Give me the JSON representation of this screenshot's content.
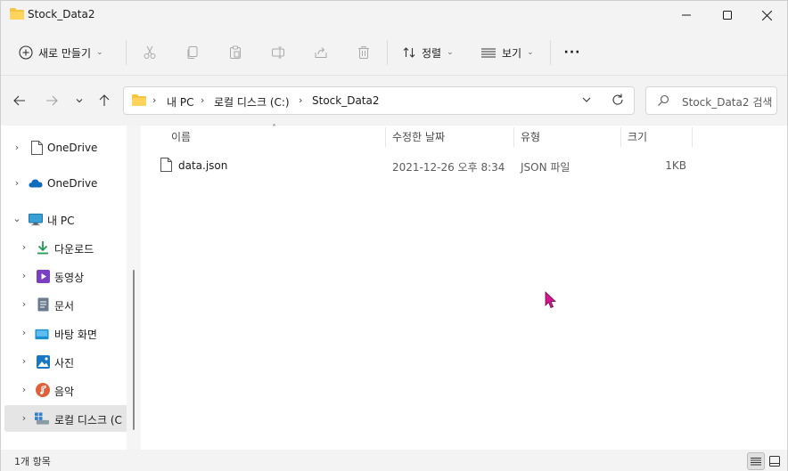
{
  "window": {
    "title": "Stock_Data2",
    "accent": "#e8b400"
  },
  "toolbar": {
    "new_label": "새로 만들기",
    "sort_label": "정렬",
    "view_label": "보기",
    "more_label": "···"
  },
  "address": {
    "crumbs": [
      "내 PC",
      "로컬 디스크 (C:)",
      "Stock_Data2"
    ]
  },
  "search": {
    "placeholder": "Stock_Data2 검색"
  },
  "sidebar": {
    "items": [
      {
        "label": "OneDrive",
        "icon": "document-icon"
      },
      {
        "label": "OneDrive",
        "icon": "cloud-icon"
      },
      {
        "label": "내 PC",
        "icon": "computer-icon"
      },
      {
        "label": "다운로드",
        "icon": "download-icon"
      },
      {
        "label": "동영상",
        "icon": "video-icon"
      },
      {
        "label": "문서",
        "icon": "documents-icon"
      },
      {
        "label": "바탕 화면",
        "icon": "desktop-icon"
      },
      {
        "label": "사진",
        "icon": "pictures-icon"
      },
      {
        "label": "음악",
        "icon": "music-icon"
      },
      {
        "label": "로컬 디스크 (C",
        "icon": "drive-icon"
      }
    ]
  },
  "columns": {
    "name": "이름",
    "modified": "수정한 날짜",
    "type": "유형",
    "size": "크기"
  },
  "files": [
    {
      "name": "data.json",
      "modified": "2021-12-26 오후 8:34",
      "type": "JSON 파일",
      "size": "1KB"
    }
  ],
  "status": {
    "count": "1개 항목"
  }
}
